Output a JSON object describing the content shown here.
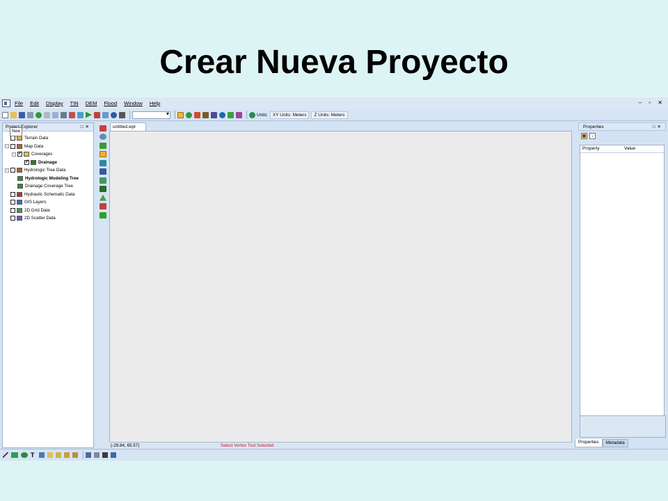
{
  "slide": {
    "title": "Crear Nueva Proyecto"
  },
  "menu": [
    "File",
    "Edit",
    "Display",
    "TIN",
    "DEM",
    "Flood",
    "Window",
    "Help"
  ],
  "window_controls": "– ▫ ✕",
  "toolbar": {
    "combo_value": "",
    "units_label": "Units",
    "xy_units": "XY Units: Meters",
    "z_units": "Z Units: Meters"
  },
  "project_explorer": {
    "title": "Project Explorer",
    "tooltip": "New",
    "items": [
      {
        "label": "Terrain Data",
        "level": 0,
        "exp": "",
        "checked": false,
        "icon": "terrain-data-icon",
        "color": "#e8a54a"
      },
      {
        "label": "Map Data",
        "level": 0,
        "exp": "−",
        "checked": false,
        "icon": "map-data-icon",
        "color": "#c0602a"
      },
      {
        "label": "Coverages",
        "level": 1,
        "exp": "−",
        "checked": true,
        "icon": "coverages-icon",
        "color": "#e0c040"
      },
      {
        "label": "Drainage",
        "level": 2,
        "exp": "",
        "checked": true,
        "icon": "eye-icon",
        "color": "#2a7a2a",
        "bold": true
      },
      {
        "label": "Hydrologic Tree Data",
        "level": 0,
        "exp": "−",
        "checked": false,
        "icon": "tree-data-icon",
        "color": "#b86020"
      },
      {
        "label": "Hydrologic Modeling Tree",
        "level": 1,
        "exp": "",
        "checked": null,
        "icon": "tree-icon",
        "color": "#3a8a3a",
        "bold": true
      },
      {
        "label": "Drainage Coverage Tree",
        "level": 1,
        "exp": "",
        "checked": null,
        "icon": "tree-icon",
        "color": "#3a8a3a"
      },
      {
        "label": "Hydraulic Schematic Data",
        "level": 0,
        "exp": "",
        "checked": false,
        "icon": "schematic-icon",
        "color": "#c03030"
      },
      {
        "label": "GIS Layers",
        "level": 0,
        "exp": "",
        "checked": false,
        "icon": "globe-icon",
        "color": "#3a70c0"
      },
      {
        "label": "2D Grid Data",
        "level": 0,
        "exp": "",
        "checked": false,
        "icon": "grid-icon",
        "color": "#40a040"
      },
      {
        "label": "2D Scatter Data",
        "level": 0,
        "exp": "",
        "checked": false,
        "icon": "scatter-icon",
        "color": "#8050c0"
      }
    ]
  },
  "document": {
    "tab_label": "untitled.wpr"
  },
  "status": {
    "coords": "(-29.84, 65.57)",
    "message": "Select Vertex Tool Selected",
    "message_color": "#d01c1c"
  },
  "properties": {
    "title": "Properties",
    "columns": [
      "Property",
      "Value"
    ],
    "tabs": [
      "Properties",
      "Metadata"
    ]
  }
}
